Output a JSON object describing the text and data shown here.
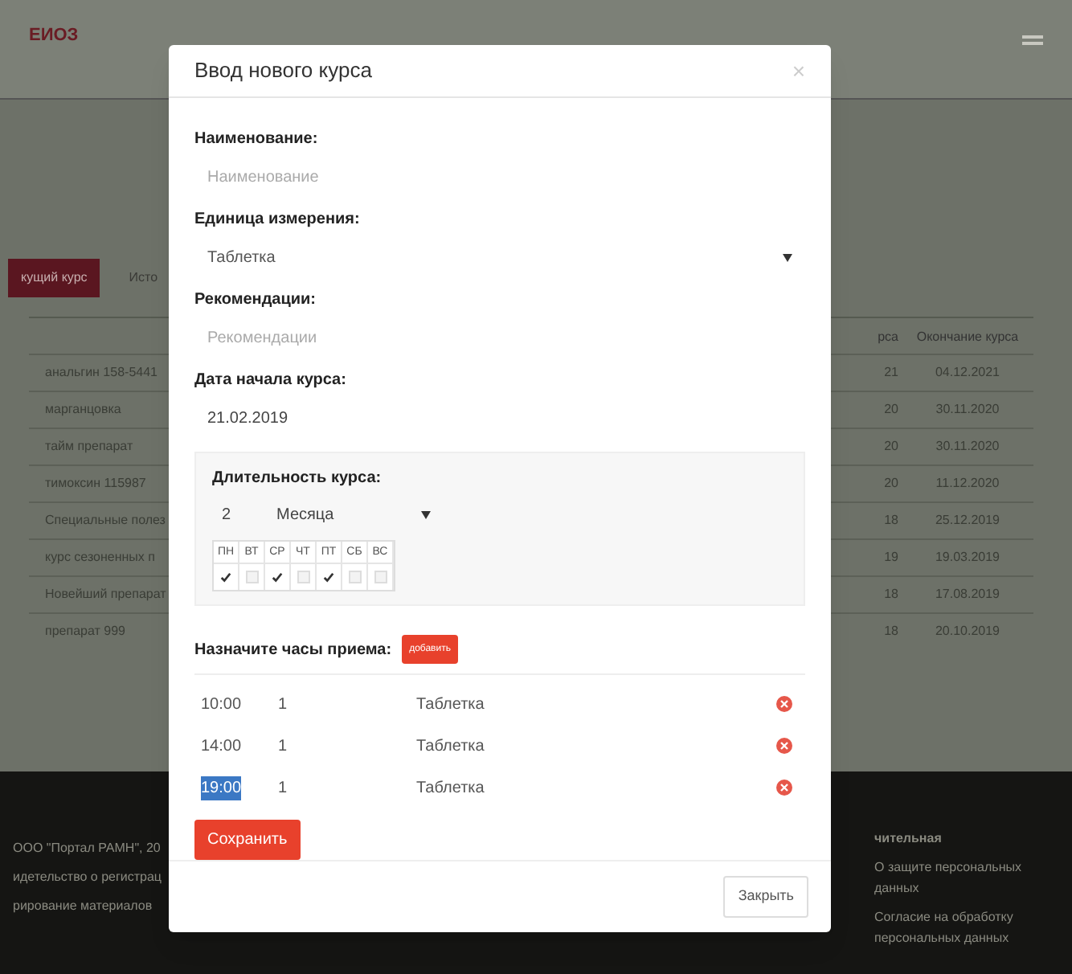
{
  "header": {
    "logo": "ЕИОЗ"
  },
  "tabs": [
    {
      "label": "кущий курс",
      "selected": true
    },
    {
      "label": "Исто",
      "selected": false
    }
  ],
  "table": {
    "columns": [
      "рса",
      "Окончание курса"
    ],
    "rows": [
      {
        "name": "анальгин 158-5441",
        "start": "21",
        "end": "04.12.2021"
      },
      {
        "name": "марганцовка",
        "start": "20",
        "end": "30.11.2020"
      },
      {
        "name": "тайм препарат",
        "start": "20",
        "end": "30.11.2020"
      },
      {
        "name": "тимоксин 115987",
        "start": "20",
        "end": "11.12.2020"
      },
      {
        "name": "Специальные полез",
        "start": "18",
        "end": "25.12.2019"
      },
      {
        "name": "курс сезоненных п",
        "start": "19",
        "end": "19.03.2019"
      },
      {
        "name": "Новейший препарат",
        "start": "18",
        "end": "17.08.2019"
      },
      {
        "name": "препарат 999",
        "start": "18",
        "end": "20.10.2019"
      }
    ]
  },
  "footer": {
    "left_lines": [
      "ООО \"Портал РАМН\", 20",
      "идетельство о регистрац",
      "рирование материалов"
    ],
    "right_title": "чительная",
    "right_links": [
      "О защите персональных данных",
      "Согласие на обработку персональных данных"
    ]
  },
  "modal": {
    "title": "Ввод нового курса",
    "close": "×",
    "fields": [
      {
        "kind": "text",
        "label": "Наименование:",
        "placeholder": "Наименование"
      },
      {
        "kind": "select",
        "label": "Единица измерения:",
        "value": "Таблетка"
      },
      {
        "kind": "text",
        "label": "Рекомендации:",
        "placeholder": "Рекомендации"
      },
      {
        "kind": "text",
        "label": "Дата начала курса:",
        "value": "21.02.2019"
      }
    ],
    "duration": {
      "title": "Длительность курса:",
      "count": "2",
      "unit": "Месяца",
      "days": [
        {
          "label": "ПН",
          "checked": true
        },
        {
          "label": "ВТ",
          "checked": false
        },
        {
          "label": "СР",
          "checked": true
        },
        {
          "label": "ЧТ",
          "checked": false
        },
        {
          "label": "ПТ",
          "checked": true
        },
        {
          "label": "СБ",
          "checked": false
        },
        {
          "label": "ВС",
          "checked": false
        }
      ]
    },
    "schedule": {
      "title": "Назначите часы приема:",
      "add_button": "добавить",
      "rows": [
        {
          "time": "10:00",
          "count": "1",
          "unit": "Таблетка",
          "selected": false
        },
        {
          "time": "14:00",
          "count": "1",
          "unit": "Таблетка",
          "selected": false
        },
        {
          "time": "19:00",
          "count": "1",
          "unit": "Таблетка",
          "selected": true
        }
      ]
    },
    "save_button": "Сохранить",
    "close_button": "Закрыть"
  }
}
